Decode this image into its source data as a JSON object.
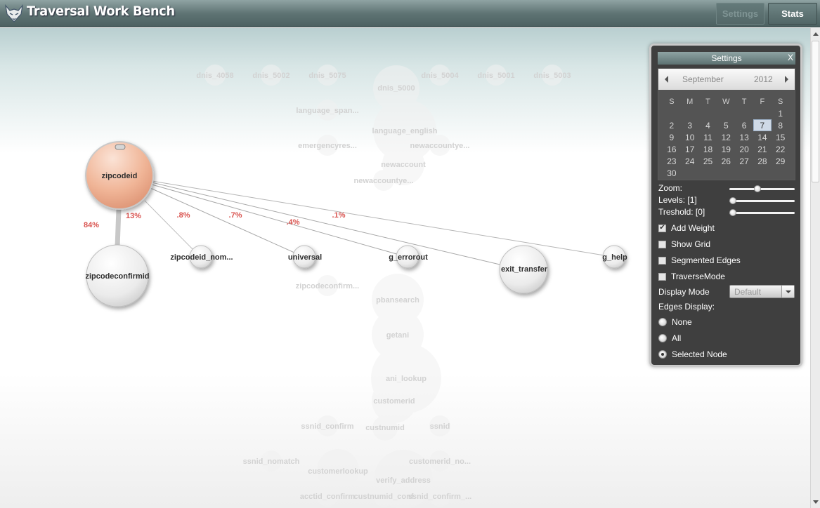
{
  "header": {
    "title": "Traversal Work Bench",
    "settings_label": "Settings",
    "stats_label": "Stats"
  },
  "graph": {
    "focus_node": "zipcodeid",
    "nodes": [
      {
        "label": "zipcodeid"
      },
      {
        "label": "zipcodeconfirmid"
      },
      {
        "label": "zipcodeid_nom..."
      },
      {
        "label": "universal"
      },
      {
        "label": "g_errorout"
      },
      {
        "label": "exit_transfer"
      },
      {
        "label": "g_help"
      }
    ],
    "edge_labels": [
      "84%",
      "13%",
      ".8%",
      ".7%",
      ".4%",
      ".1%"
    ],
    "ghost_nodes": [
      "dnis_4058",
      "dnis_5002",
      "dnis_5075",
      "dnis_5000",
      "dnis_5004",
      "dnis_5001",
      "dnis_5003",
      "language_span...",
      "language_english",
      "emergencyres...",
      "newaccountye...",
      "newaccount",
      "newaccountye...",
      "zipcodeconfirm...",
      "pbansearch",
      "getani",
      "ani_lookup",
      "customerid",
      "ssnid_confirm",
      "custnumid",
      "ssnid",
      "ssnid_nomatch",
      "customerlookup",
      "customerid_no...",
      "verify_address",
      "acctid_confirm",
      "custnumid_conf",
      "ssnid_confirm_..."
    ]
  },
  "settings_panel": {
    "title": "Settings",
    "close_label": "X",
    "calendar": {
      "month": "September",
      "year": "2012",
      "weekdays": [
        "S",
        "M",
        "T",
        "W",
        "T",
        "F",
        "S"
      ],
      "selected_day": "7",
      "weeks": [
        [
          "",
          "",
          "",
          "",
          "",
          "",
          "1"
        ],
        [
          "2",
          "3",
          "4",
          "5",
          "6",
          "7",
          "8"
        ],
        [
          "9",
          "10",
          "11",
          "12",
          "13",
          "14",
          "15"
        ],
        [
          "16",
          "17",
          "18",
          "19",
          "20",
          "21",
          "22"
        ],
        [
          "23",
          "24",
          "25",
          "26",
          "27",
          "28",
          "29"
        ],
        [
          "30",
          "",
          "",
          "",
          "",
          "",
          ""
        ]
      ]
    },
    "zoom_label": "Zoom:",
    "zoom_value": 0.42,
    "levels_label": "Levels: [1]",
    "levels_value": 0,
    "treshold_label": "Treshold: [0]",
    "treshold_value": 0,
    "checkboxes": [
      {
        "label": "Add Weight",
        "checked": true
      },
      {
        "label": "Show Grid",
        "checked": false
      },
      {
        "label": "Segmented Edges",
        "checked": false
      },
      {
        "label": "TraverseMode",
        "checked": false
      }
    ],
    "display_mode_label": "Display Mode",
    "display_mode_value": "Default",
    "edges_display_label": "Edges Display:",
    "edges_options": [
      {
        "label": "None",
        "selected": false
      },
      {
        "label": "All",
        "selected": false
      },
      {
        "label": "Selected Node",
        "selected": true
      }
    ]
  },
  "colors": {
    "header": "#5f7474",
    "focus_node": "#f0b597",
    "edge_label": "#d9534f",
    "panel": "#3f3f3f"
  }
}
